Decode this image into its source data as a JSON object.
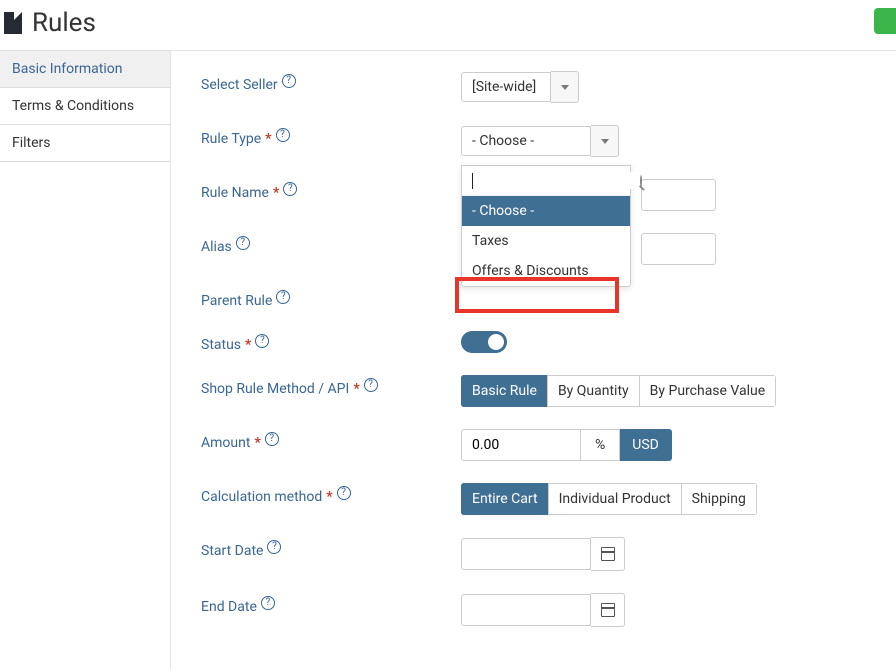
{
  "pageTitle": "Rules",
  "sidebar": {
    "items": [
      {
        "label": "Basic Information",
        "active": true
      },
      {
        "label": "Terms & Conditions",
        "active": false
      },
      {
        "label": "Filters",
        "active": false
      }
    ]
  },
  "labels": {
    "selectSeller": "Select Seller",
    "ruleType": "Rule Type",
    "ruleName": "Rule Name",
    "alias": "Alias",
    "parentRule": "Parent Rule",
    "status": "Status",
    "shopMethod": "Shop Rule Method / API",
    "amount": "Amount",
    "calcMethod": "Calculation method",
    "startDate": "Start Date",
    "endDate": "End Date"
  },
  "seller": {
    "value": "[Site-wide]"
  },
  "ruleType": {
    "value": "- Choose -",
    "search": "",
    "options": [
      {
        "label": "- Choose -",
        "selected": true
      },
      {
        "label": "Taxes",
        "selected": false
      },
      {
        "label": "Offers & Discounts",
        "selected": false,
        "highlighted": true
      }
    ]
  },
  "ruleName": "",
  "alias": "",
  "parentRule": "",
  "status": true,
  "shopMethod": {
    "options": [
      {
        "label": "Basic Rule",
        "active": true
      },
      {
        "label": "By Quantity",
        "active": false
      },
      {
        "label": "By Purchase Value",
        "active": false
      }
    ]
  },
  "amount": {
    "value": "0.00",
    "pct": "%",
    "currency": "USD"
  },
  "calcMethod": {
    "options": [
      {
        "label": "Entire Cart",
        "active": true
      },
      {
        "label": "Individual Product",
        "active": false
      },
      {
        "label": "Shipping",
        "active": false
      }
    ]
  },
  "startDate": "",
  "endDate": ""
}
